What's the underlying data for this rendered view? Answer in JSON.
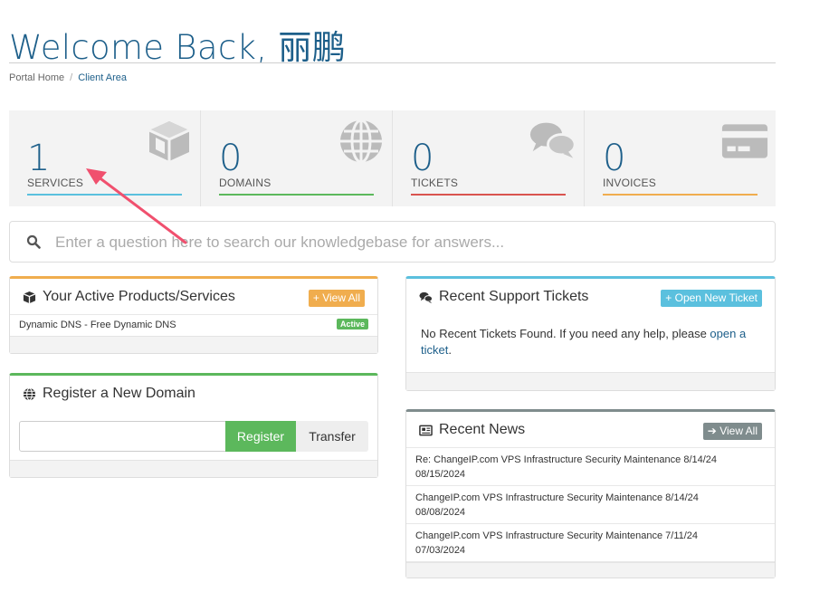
{
  "header": {
    "title": "Welcome Back, 丽鹏"
  },
  "breadcrumb": {
    "home": "Portal Home",
    "separator": "/",
    "current": "Client Area"
  },
  "tiles": [
    {
      "count": "1",
      "label": "SERVICES",
      "icon": "cube-icon",
      "color": "#5bc0de"
    },
    {
      "count": "0",
      "label": "DOMAINS",
      "icon": "globe-icon",
      "color": "#5cb85c"
    },
    {
      "count": "0",
      "label": "TICKETS",
      "icon": "comments-icon",
      "color": "#d9534f"
    },
    {
      "count": "0",
      "label": "INVOICES",
      "icon": "credit-card-icon",
      "color": "#f0ad4e"
    }
  ],
  "search": {
    "placeholder": "Enter a question here to search our knowledgebase for answers..."
  },
  "products": {
    "title": "Your Active Products/Services",
    "button": "View All",
    "items": [
      {
        "name": "Dynamic DNS - Free Dynamic DNS",
        "status": "Active"
      }
    ]
  },
  "domain": {
    "title": "Register a New Domain",
    "register": "Register",
    "transfer": "Transfer"
  },
  "tickets": {
    "title": "Recent Support Tickets",
    "button": "Open New Ticket",
    "message": "No Recent Tickets Found. If you need any help, please ",
    "link": "open a ticket",
    "end": "."
  },
  "news": {
    "title": "Recent News",
    "button": "View All",
    "items": [
      {
        "title": "Re: ChangeIP.com VPS Infrastructure Security Maintenance 8/14/24",
        "date": "08/15/2024"
      },
      {
        "title": "ChangeIP.com VPS Infrastructure Security Maintenance 8/14/24",
        "date": "08/08/2024"
      },
      {
        "title": "ChangeIP.com VPS Infrastructure Security Maintenance 7/11/24",
        "date": "07/03/2024"
      }
    ]
  },
  "colors": {
    "brand": "#1d5f8a",
    "warning": "#f0ad4e",
    "success": "#5cb85c",
    "info": "#5bc0de",
    "danger": "#d9534f",
    "news": "#7f8c8d",
    "annotation_arrow": "#f0506e"
  }
}
